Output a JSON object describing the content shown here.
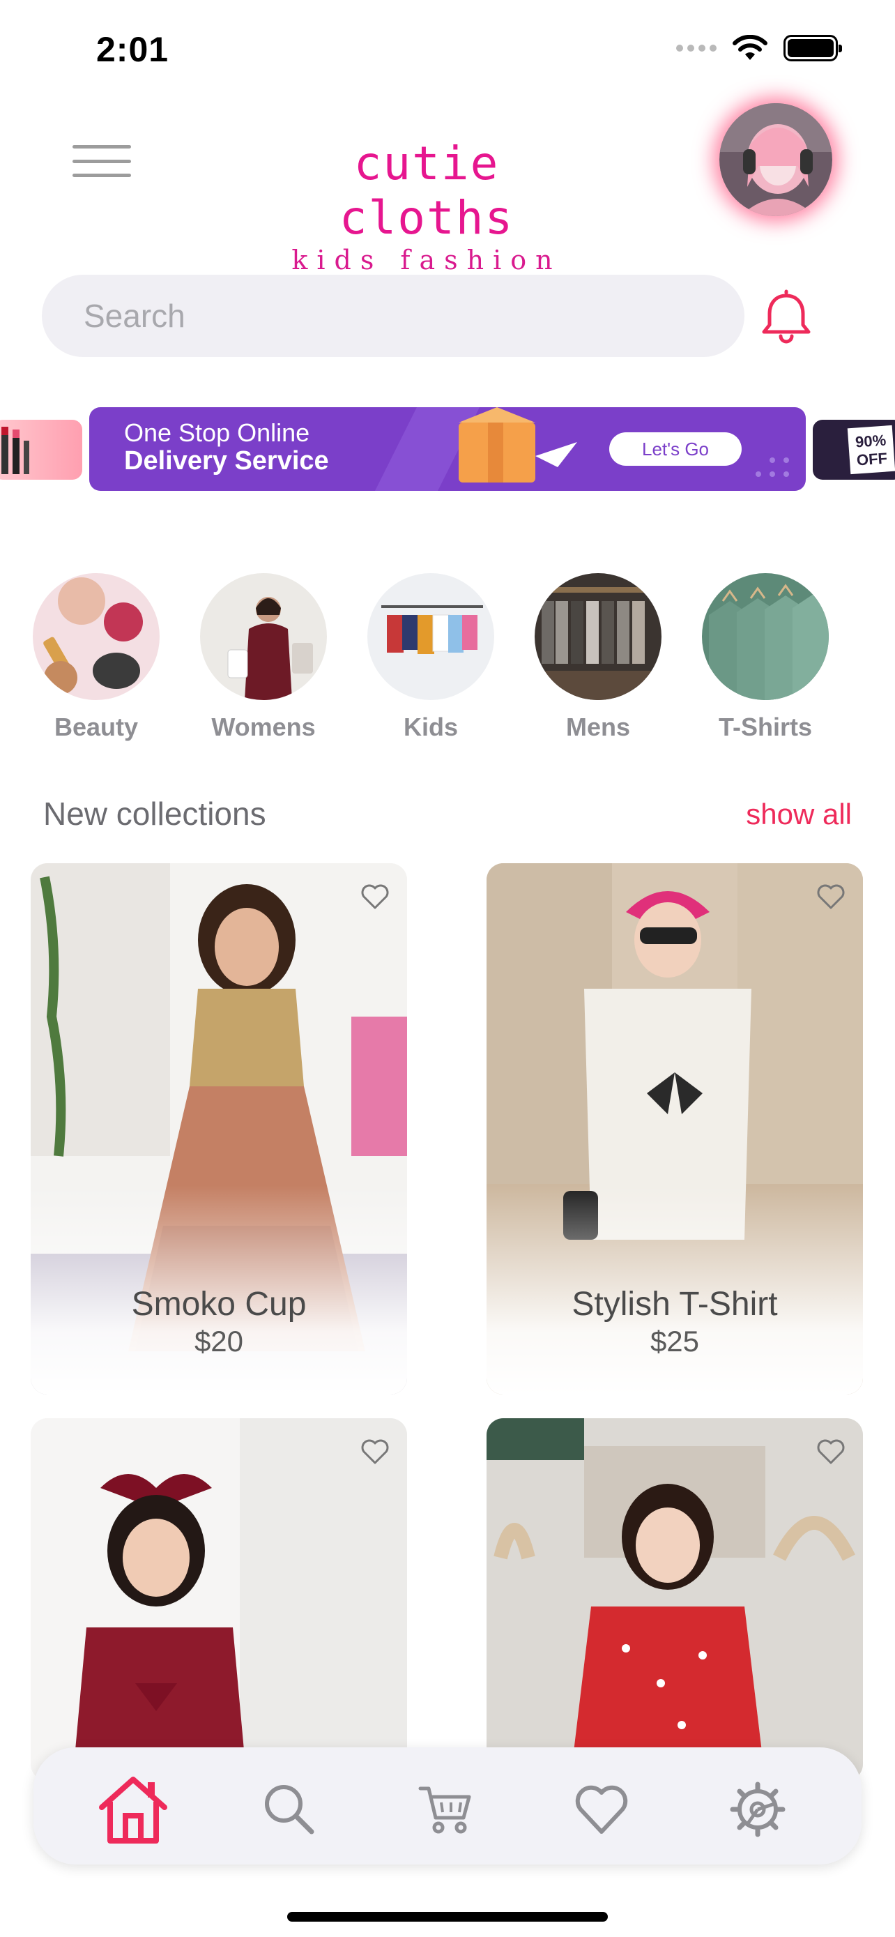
{
  "status_bar": {
    "time": "2:01"
  },
  "header": {
    "logo_title": "cutie cloths",
    "logo_subtitle": "kids fashion"
  },
  "search": {
    "placeholder": "Search"
  },
  "banner": {
    "line1": "One Stop Online",
    "line2": "Delivery Service",
    "cta": "Let's Go",
    "right_badge": "90% OFF"
  },
  "categories": [
    {
      "label": "Beauty"
    },
    {
      "label": "Womens"
    },
    {
      "label": "Kids"
    },
    {
      "label": "Mens"
    },
    {
      "label": "T-Shirts"
    }
  ],
  "section": {
    "title": "New collections",
    "show_all": "show all"
  },
  "products": [
    {
      "name": "Smoko Cup",
      "price": "$20"
    },
    {
      "name": "Stylish T-Shirt",
      "price": "$25"
    },
    {
      "name": "",
      "price": ""
    },
    {
      "name": "",
      "price": ""
    }
  ],
  "nav": {
    "items": [
      "home-icon",
      "search-icon",
      "cart-icon",
      "heart-icon",
      "settings-icon"
    ],
    "active": "home-icon"
  },
  "colors": {
    "accent": "#ee2a5a",
    "brand_pink": "#e6168f",
    "banner_purple": "#7b3fc9",
    "nav_inactive": "#8e8e93"
  }
}
